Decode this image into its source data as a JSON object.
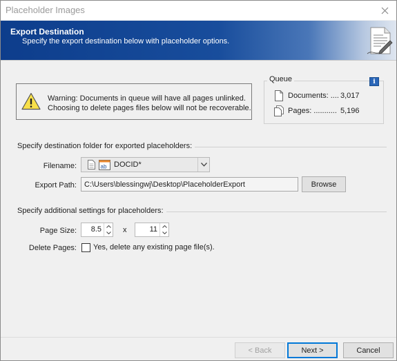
{
  "window": {
    "title": "Placeholder Images"
  },
  "banner": {
    "title": "Export Destination",
    "subtitle": "Specify the export destination below with placeholder options.",
    "gradient_start": "#0d3d8c",
    "icon": "document-with-pen-icon"
  },
  "warning": {
    "icon": "warning-triangle-icon",
    "line1": "Warning: Documents in queue will have all pages unlinked.",
    "line2": "Choosing to delete pages files below will not be recoverable."
  },
  "queue": {
    "label": "Queue",
    "info_icon": "i",
    "documents_label": "Documents: ....",
    "documents_count": "3,017",
    "pages_label": "Pages: ...........",
    "pages_count": "5,196"
  },
  "destination": {
    "section_label": "Specify destination folder for exported placeholders:",
    "filename_label": "Filename:",
    "filename_value": "DOCID*",
    "export_path_label": "Export Path:",
    "export_path_value": "C:\\Users\\blessingwj\\Desktop\\PlaceholderExport",
    "browse_label": "Browse"
  },
  "settings": {
    "section_label": "Specify additional settings for placeholders:",
    "page_size_label": "Page Size:",
    "width_value": "8.5",
    "x_label": "x",
    "height_value": "11",
    "delete_label": "Delete Pages:",
    "delete_checkbox_text": "Yes, delete any existing page file(s).",
    "delete_checked": false
  },
  "footer": {
    "back_label": "< Back",
    "next_label": "Next >",
    "cancel_label": "Cancel",
    "accent": "#0078d7"
  }
}
